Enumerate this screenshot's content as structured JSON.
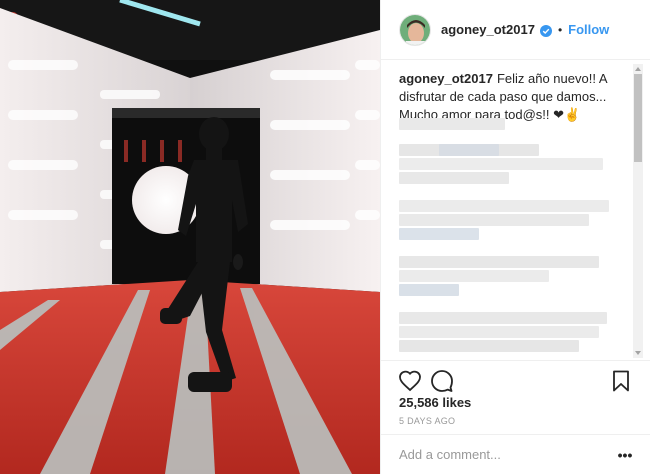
{
  "post": {
    "username": "agoney_ot2017",
    "follow_label": "Follow",
    "separator": "•",
    "caption_user": "agoney_ot2017",
    "caption_text": "Feliz año nuevo!! A disfrutar de cada paso que damos... Mucho amor para tod@s!! ❤✌",
    "likes": "25,586 likes",
    "time_ago": "5 DAYS AGO",
    "more_label": "•••"
  },
  "comment_box": {
    "placeholder": "Add a comment..."
  },
  "icons": {
    "like": "heart-icon",
    "comment": "comment-bubble-icon",
    "save": "bookmark-icon",
    "verified": "verified-badge-icon",
    "more": "more-options-icon"
  },
  "colors": {
    "accent": "#3897f0",
    "text": "#262626",
    "muted": "#999999",
    "floor": "#c0392b"
  }
}
